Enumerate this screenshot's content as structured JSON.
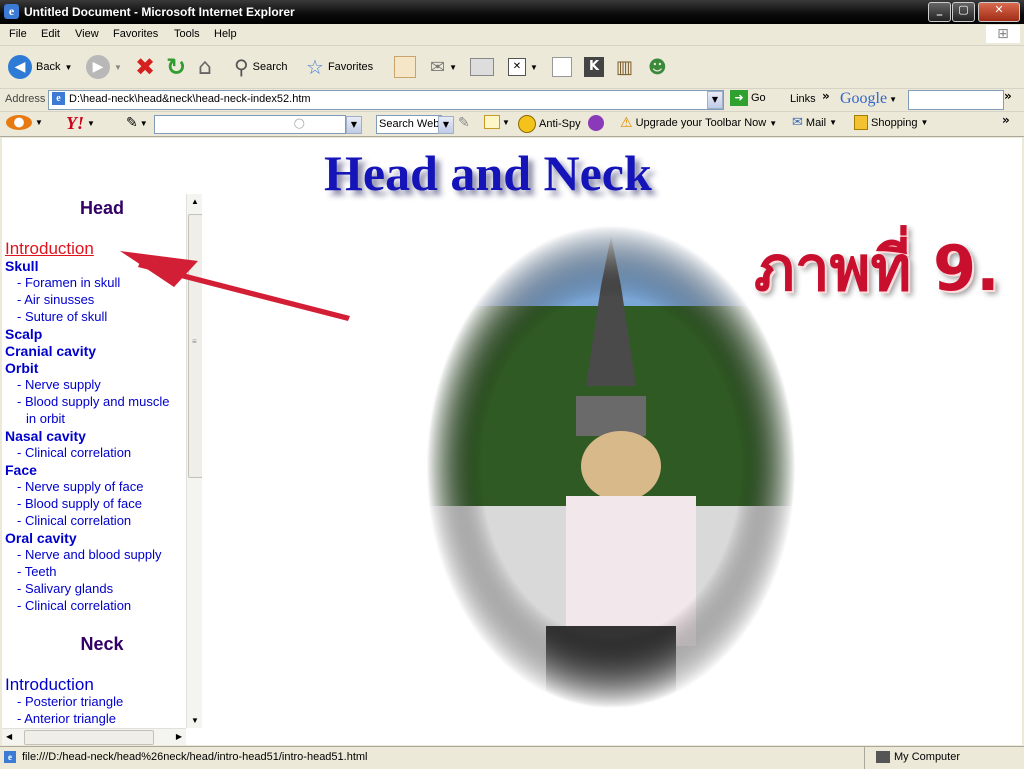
{
  "window": {
    "title": "Untitled Document - Microsoft Internet Explorer"
  },
  "menu": [
    "File",
    "Edit",
    "View",
    "Favorites",
    "Tools",
    "Help"
  ],
  "toolbar": {
    "back": "Back",
    "search": "Search",
    "favorites": "Favorites"
  },
  "address": {
    "label": "Address",
    "value": "D:\\head-neck\\head&neck\\head-neck-index52.htm",
    "go": "Go",
    "links": "Links",
    "google": "Google"
  },
  "yahoo_toolbar": {
    "search_web": "Search Web",
    "anti_spy": "Anti-Spy",
    "upgrade": "Upgrade your Toolbar Now",
    "mail": "Mail",
    "shopping": "Shopping"
  },
  "page": {
    "heading": "Head and Neck",
    "thai_label": "ภาพที่ 9.",
    "sidebar": {
      "head_section": "Head",
      "items": [
        "Introduction",
        "Skull",
        "- Foramen in skull",
        "- Air sinusses",
        "- Suture of skull",
        "Scalp",
        "Cranial cavity",
        "Orbit",
        "- Nerve supply",
        "- Blood supply and muscle",
        "in orbit",
        "Nasal cavity",
        "- Clinical correlation",
        "Face",
        "- Nerve supply of face",
        "- Blood supply of face",
        "- Clinical correlation",
        "Oral cavity",
        "- Nerve and blood supply",
        "- Teeth",
        "- Salivary glands",
        "- Clinical correlation"
      ],
      "neck_section": "Neck",
      "neck_items": [
        "Introduction",
        "- Posterior triangle",
        "- Anterior triangle"
      ]
    }
  },
  "status": {
    "url": "file:///D:/head-neck/head%26neck/head/intro-head51/intro-head51.html",
    "zone": "My Computer"
  }
}
